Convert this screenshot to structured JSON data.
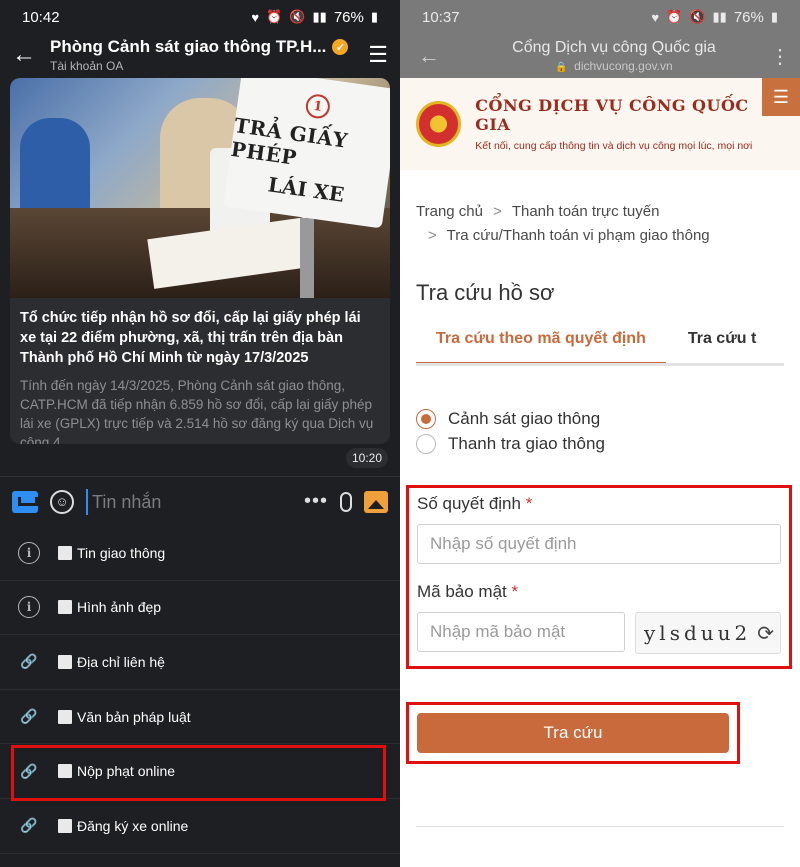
{
  "left": {
    "status": {
      "time": "10:42",
      "battery": "76%"
    },
    "appbar": {
      "title": "Phòng Cảnh sát giao thông TP.H...",
      "subtitle": "Tài khoản OA"
    },
    "article": {
      "sign_line1": "TRẢ GIẤY PHÉP",
      "sign_line2": "LÁI XE",
      "sign_badge": "1",
      "headline": "Tổ chức tiếp nhận hồ sơ đổi, cấp lại giấy phép lái xe tại 22 điểm phường, xã, thị trấn trên địa bàn Thành phố Hồ Chí Minh từ ngày 17/3/2025",
      "description": "Tính đến ngày 14/3/2025, Phòng Cảnh sát giao thông, CATP.HCM đã tiếp nhận 6.859 hồ sơ đổi, cấp lại giấy phép lái xe (GPLX) trực tiếp và 2.514 hồ sơ đăng ký qua Dịch vụ công 4",
      "time": "10:20"
    },
    "composer": {
      "placeholder": "Tin nhắn"
    },
    "menu": [
      {
        "label": "Tin giao thông",
        "icon": "info-icon"
      },
      {
        "label": "Hình ảnh đẹp",
        "icon": "info-icon"
      },
      {
        "label": "Địa chỉ liên hệ",
        "icon": "link-icon"
      },
      {
        "label": "Văn bản pháp luật",
        "icon": "link-icon"
      },
      {
        "label": "Nộp phạt online",
        "icon": "link-icon"
      },
      {
        "label": "Đăng ký xe online",
        "icon": "link-icon"
      }
    ]
  },
  "right": {
    "status": {
      "time": "10:37",
      "battery": "76%"
    },
    "appbar": {
      "title": "Cổng Dịch vụ công Quốc gia",
      "url": "dichvucong.gov.vn"
    },
    "brand": {
      "name": "CỔNG DỊCH VỤ CÔNG QUỐC GIA",
      "slogan": "Kết nối, cung cấp thông tin và dịch vụ công mọi lúc, mọi nơi"
    },
    "breadcrumb": {
      "home": "Trang chủ",
      "level2": "Thanh toán trực tuyến",
      "level3": "Tra cứu/Thanh toán vi phạm giao thông"
    },
    "page_title": "Tra cứu hồ sơ",
    "tabs": {
      "active": "Tra cứu theo mã quyết định",
      "inactive": "Tra cứu t"
    },
    "radios": {
      "option1": "Cảnh sát giao thông",
      "option2": "Thanh tra giao thông"
    },
    "form": {
      "decision_label": "Số quyết định",
      "decision_placeholder": "Nhập số quyết định",
      "security_label": "Mã bảo mật",
      "security_placeholder": "Nhập mã bảo mật",
      "captcha": "ylsduu2",
      "required_mark": "*"
    },
    "submit_label": "Tra cứu"
  },
  "colors": {
    "accent": "#c96a3c",
    "highlight_box": "#e01010",
    "brand_red": "#9c2b1e",
    "dark_bg": "#1e1f22"
  }
}
